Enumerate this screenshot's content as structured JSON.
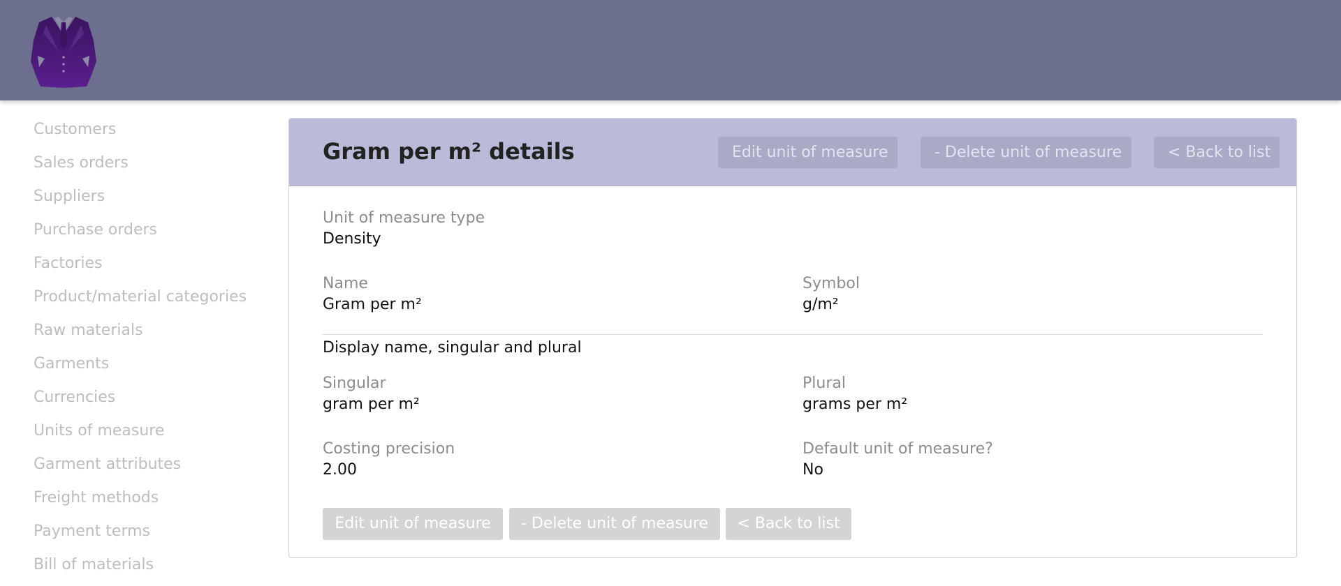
{
  "sidebar": {
    "items": [
      {
        "label": "Customers"
      },
      {
        "label": "Sales orders"
      },
      {
        "label": "Suppliers"
      },
      {
        "label": "Purchase orders"
      },
      {
        "label": "Factories"
      },
      {
        "label": "Product/material categories"
      },
      {
        "label": "Raw materials"
      },
      {
        "label": "Garments"
      },
      {
        "label": "Currencies"
      },
      {
        "label": "Units of measure"
      },
      {
        "label": "Garment attributes"
      },
      {
        "label": "Freight methods"
      },
      {
        "label": "Payment terms"
      },
      {
        "label": "Bill of materials"
      }
    ]
  },
  "panel": {
    "title": "Gram per m² details",
    "header_buttons": {
      "edit": "Edit unit of measure",
      "delete": "- Delete unit of measure",
      "back": "< Back to list"
    },
    "fields": {
      "uom_type": {
        "label": "Unit of measure type",
        "value": "Density"
      },
      "name": {
        "label": "Name",
        "value": "Gram per m²"
      },
      "symbol": {
        "label": "Symbol",
        "value": "g/m²"
      },
      "singular": {
        "label": "Singular",
        "value": "gram per m²"
      },
      "plural": {
        "label": "Plural",
        "value": "grams per m²"
      },
      "costing_precision": {
        "label": "Costing precision",
        "value": "2.00"
      },
      "default_uom": {
        "label": "Default unit of measure?",
        "value": "No"
      }
    },
    "display_section_title": "Display name, singular and plural",
    "footer_buttons": {
      "edit": "Edit unit of measure",
      "delete": "- Delete unit of measure",
      "back": "< Back to list"
    }
  },
  "colors": {
    "topbar": "#6c6f8e",
    "panel_header": "#babbd8",
    "logo_purple": "#4a1a73"
  },
  "icons": {
    "logo": "suit-jacket-icon"
  }
}
